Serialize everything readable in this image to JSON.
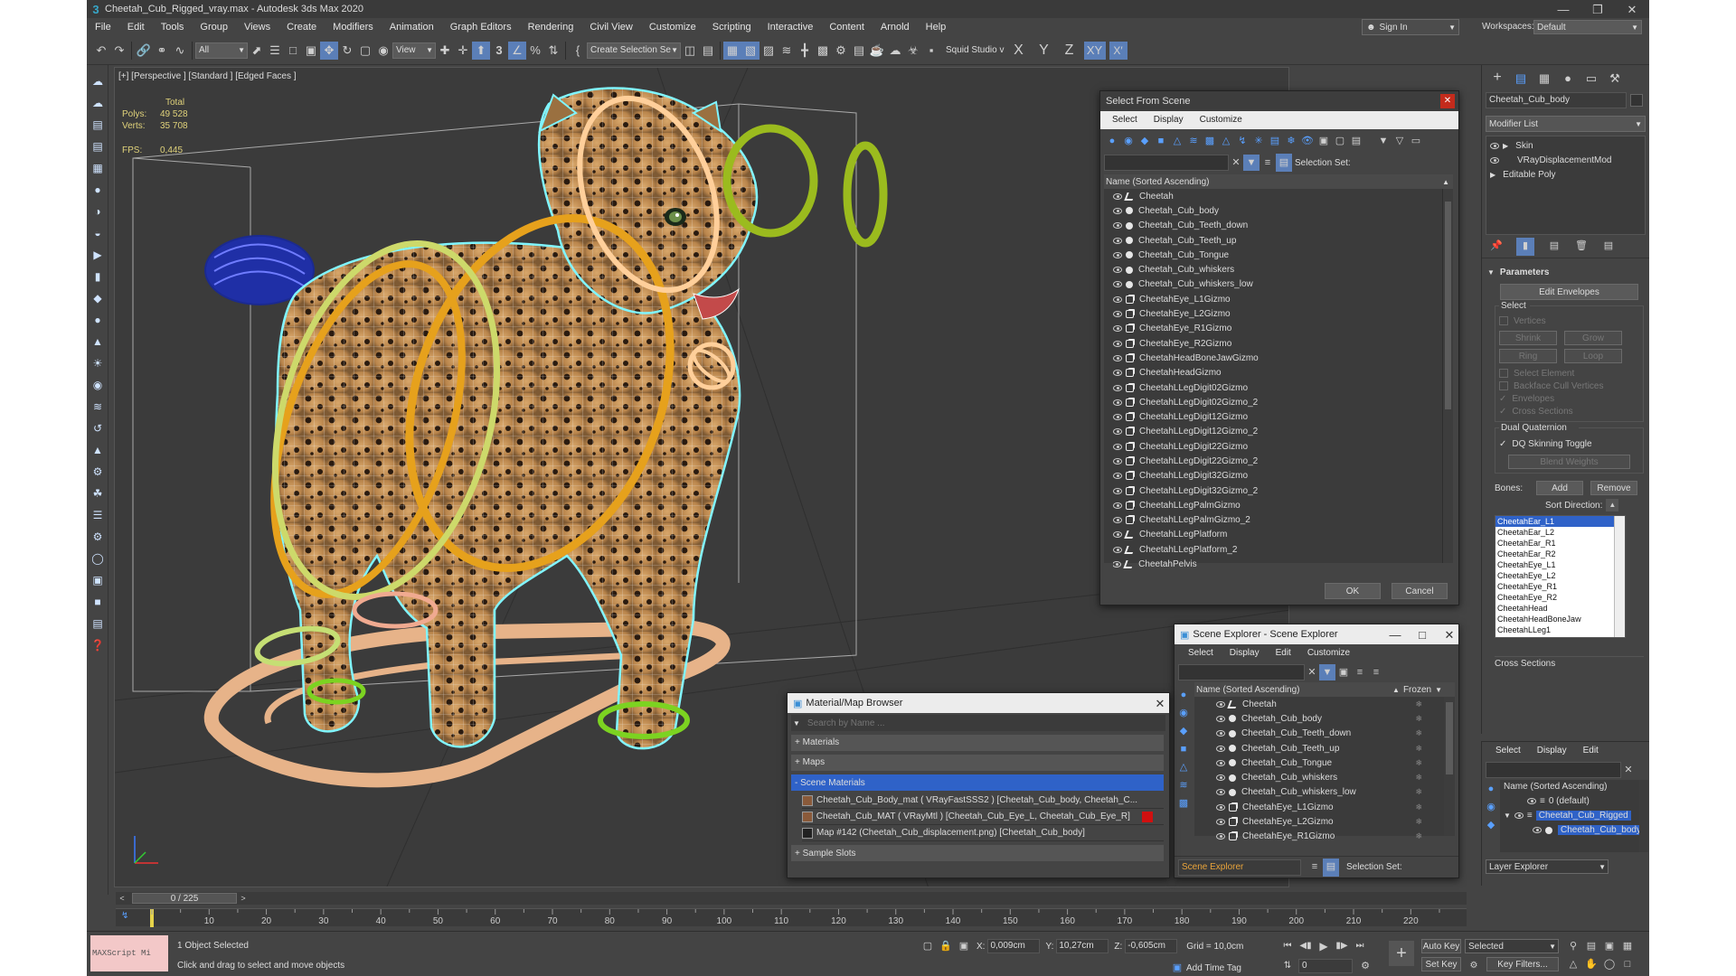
{
  "title": "Cheetah_Cub_Rigged_vray.max - Autodesk 3ds Max 2020",
  "menu": [
    "File",
    "Edit",
    "Tools",
    "Group",
    "Views",
    "Create",
    "Modifiers",
    "Animation",
    "Graph Editors",
    "Rendering",
    "Civil View",
    "Customize",
    "Scripting",
    "Interactive",
    "Content",
    "Arnold",
    "Help"
  ],
  "sign_in": "Sign In",
  "workspaces_label": "Workspaces:",
  "workspace_value": "Default",
  "toolbar": {
    "filter_all": "All",
    "view_label": "View",
    "create_selection_set": "Create Selection Se",
    "squid": "Squid Studio v",
    "axis_x": "X",
    "axis_y": "Y",
    "axis_z": "Z",
    "axis_xy": "XY"
  },
  "viewport": {
    "label": "[+] [Perspective ] [Standard ] [Edged Faces ]",
    "stats_total": "Total",
    "polys_label": "Polys:",
    "polys_value": "49 528",
    "verts_label": "Verts:",
    "verts_value": "35 708",
    "fps_label": "FPS:",
    "fps_value": "0,445"
  },
  "select_from_scene": {
    "title": "Select From Scene",
    "menu": [
      "Select",
      "Display",
      "Customize"
    ],
    "selection_set_label": "Selection Set:",
    "header": "Name (Sorted Ascending)",
    "items": [
      {
        "name": "Cheetah",
        "type": "bone"
      },
      {
        "name": "Cheetah_Cub_body",
        "type": "dot"
      },
      {
        "name": "Cheetah_Cub_Teeth_down",
        "type": "dot"
      },
      {
        "name": "Cheetah_Cub_Teeth_up",
        "type": "dot"
      },
      {
        "name": "Cheetah_Cub_Tongue",
        "type": "dot"
      },
      {
        "name": "Cheetah_Cub_whiskers",
        "type": "dot"
      },
      {
        "name": "Cheetah_Cub_whiskers_low",
        "type": "dot"
      },
      {
        "name": "CheetahEye_L1Gizmo",
        "type": "giz"
      },
      {
        "name": "CheetahEye_L2Gizmo",
        "type": "giz"
      },
      {
        "name": "CheetahEye_R1Gizmo",
        "type": "giz"
      },
      {
        "name": "CheetahEye_R2Gizmo",
        "type": "giz"
      },
      {
        "name": "CheetahHeadBoneJawGizmo",
        "type": "giz"
      },
      {
        "name": "CheetahHeadGizmo",
        "type": "giz"
      },
      {
        "name": "CheetahLLegDigit02Gizmo",
        "type": "giz"
      },
      {
        "name": "CheetahLLegDigit02Gizmo_2",
        "type": "giz"
      },
      {
        "name": "CheetahLLegDigit12Gizmo",
        "type": "giz"
      },
      {
        "name": "CheetahLLegDigit12Gizmo_2",
        "type": "giz"
      },
      {
        "name": "CheetahLLegDigit22Gizmo",
        "type": "giz"
      },
      {
        "name": "CheetahLLegDigit22Gizmo_2",
        "type": "giz"
      },
      {
        "name": "CheetahLLegDigit32Gizmo",
        "type": "giz"
      },
      {
        "name": "CheetahLLegDigit32Gizmo_2",
        "type": "giz"
      },
      {
        "name": "CheetahLLegPalmGizmo",
        "type": "giz"
      },
      {
        "name": "CheetahLLegPalmGizmo_2",
        "type": "giz"
      },
      {
        "name": "CheetahLLegPlatform",
        "type": "bone"
      },
      {
        "name": "CheetahLLegPlatform_2",
        "type": "bone"
      },
      {
        "name": "CheetahPelvis",
        "type": "bone"
      }
    ],
    "ok": "OK",
    "cancel": "Cancel"
  },
  "scene_explorer": {
    "title": "Scene Explorer - Scene Explorer",
    "menu": [
      "Select",
      "Display",
      "Edit",
      "Customize"
    ],
    "header": "Name (Sorted Ascending)",
    "frozen": "Frozen",
    "items": [
      {
        "name": "Cheetah",
        "type": "bone"
      },
      {
        "name": "Cheetah_Cub_body",
        "type": "dot"
      },
      {
        "name": "Cheetah_Cub_Teeth_down",
        "type": "dot"
      },
      {
        "name": "Cheetah_Cub_Teeth_up",
        "type": "dot"
      },
      {
        "name": "Cheetah_Cub_Tongue",
        "type": "dot"
      },
      {
        "name": "Cheetah_Cub_whiskers",
        "type": "dot"
      },
      {
        "name": "Cheetah_Cub_whiskers_low",
        "type": "dot"
      },
      {
        "name": "CheetahEye_L1Gizmo",
        "type": "giz"
      },
      {
        "name": "CheetahEye_L2Gizmo",
        "type": "giz"
      },
      {
        "name": "CheetahEye_R1Gizmo",
        "type": "giz"
      }
    ],
    "footer_name": "Scene Explorer",
    "selection_set_label": "Selection Set:"
  },
  "material_browser": {
    "title": "Material/Map Browser",
    "search_placeholder": "Search by Name ...",
    "groups": [
      "+ Materials",
      "+ Maps"
    ],
    "scene_materials": "- Scene Materials",
    "materials": [
      "Cheetah_Cub_Body_mat  ( VRayFastSSS2 ) [Cheetah_Cub_body, Cheetah_C...",
      "Cheetah_Cub_MAT  ( VRayMtl ) [Cheetah_Cub_Eye_L, Cheetah_Cub_Eye_R]",
      "Map #142 (Cheetah_Cub_displacement.png) [Cheetah_Cub_body]"
    ],
    "sample_slots": "+ Sample Slots"
  },
  "command_panel": {
    "object_name": "Cheetah_Cub_body",
    "modifier_list": "Modifier List",
    "stack": [
      "Skin",
      "VRayDisplacementMod",
      "Editable Poly"
    ],
    "parameters": "Parameters",
    "edit_envelopes": "Edit Envelopes",
    "select_label": "Select",
    "vertices": "Vertices",
    "shrink": "Shrink",
    "grow": "Grow",
    "ring": "Ring",
    "loop": "Loop",
    "select_element": "Select Element",
    "backface_cull": "Backface Cull Vertices",
    "envelopes": "Envelopes",
    "cross_sections": "Cross Sections",
    "dual_quaternion": "Dual Quaternion",
    "dq_toggle": "DQ Skinning Toggle",
    "blend_weights": "Blend Weights",
    "bones_label": "Bones:",
    "add": "Add",
    "remove": "Remove",
    "sort_direction": "Sort Direction:",
    "bones": [
      "CheetahEar_L1",
      "CheetahEar_L2",
      "CheetahEar_R1",
      "CheetahEar_R2",
      "CheetahEye_L1",
      "CheetahEye_L2",
      "CheetahEye_R1",
      "CheetahEye_R2",
      "CheetahHead",
      "CheetahHeadBoneJaw",
      "CheetahLLeg1"
    ],
    "cross_sections_footer": "Cross Sections"
  },
  "layer_explorer": {
    "menu": [
      "Select",
      "Display",
      "Edit"
    ],
    "header": "Name (Sorted Ascending)",
    "items": [
      "0 (default)",
      "Cheetah_Cub_Rigged",
      "Cheetah_Cub_body"
    ],
    "footer": "Layer Explorer"
  },
  "timeline": {
    "frame": "0 / 225",
    "ticks": [
      "10",
      "20",
      "30",
      "40",
      "50",
      "60",
      "70",
      "80",
      "90",
      "100",
      "110",
      "120",
      "130",
      "140",
      "150",
      "160",
      "170",
      "180",
      "190",
      "200",
      "210",
      "220"
    ]
  },
  "status": {
    "script": "MAXScript Mi",
    "selected": "1 Object Selected",
    "prompt": "Click and drag to select and move objects",
    "x_label": "X:",
    "x_value": "0,009cm",
    "y_label": "Y:",
    "y_value": "10,27cm",
    "z_label": "Z:",
    "z_value": "-0,605cm",
    "grid": "Grid = 10,0cm",
    "add_time_tag": "Add Time Tag",
    "auto_key": "Auto Key",
    "selected_dd": "Selected",
    "set_key": "Set Key",
    "key_filters": "Key Filters...",
    "frame_value": "0"
  },
  "colors": {
    "accent": "#3a6fd8",
    "selection": "#2f62c8",
    "viewport_bg": "#3b3b3b",
    "ui_bg": "#444444"
  }
}
